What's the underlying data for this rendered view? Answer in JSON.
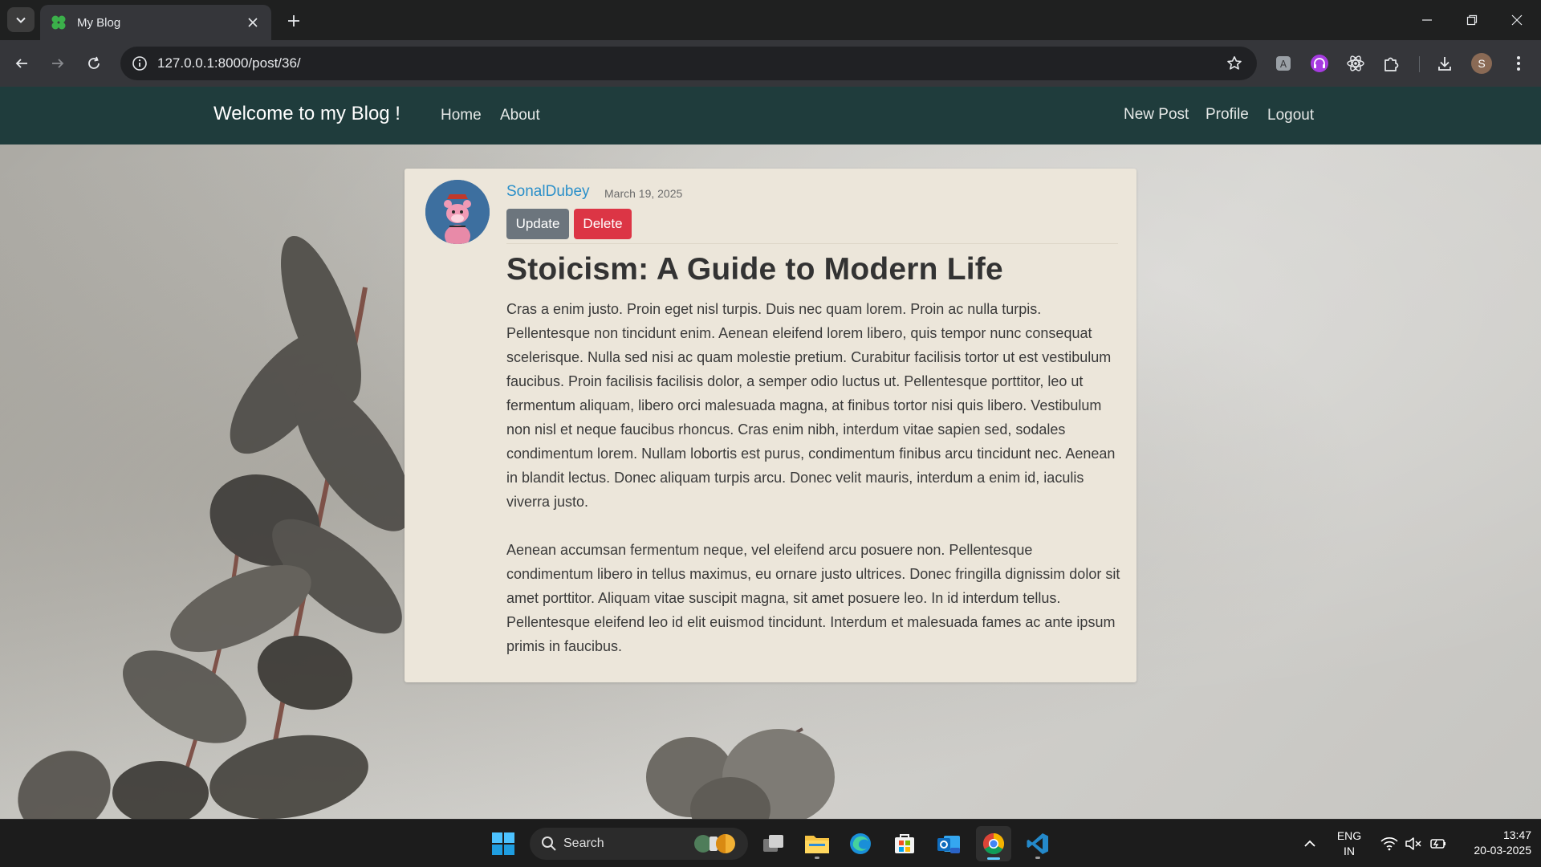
{
  "browser": {
    "tab_title": "My Blog",
    "url": "127.0.0.1:8000/post/36/",
    "profile_initial": "S"
  },
  "site": {
    "brand": "Welcome to my Blog !",
    "nav_left": [
      "Home",
      "About"
    ],
    "nav_right": [
      "New Post",
      "Profile",
      "Logout"
    ],
    "nav_bg": "#1f3c3c"
  },
  "post": {
    "author": "SonalDubey",
    "date": "March 19, 2025",
    "update_label": "Update",
    "delete_label": "Delete",
    "title": "Stoicism: A Guide to Modern Life",
    "paragraphs": [
      "Cras a enim justo. Proin eget nisl turpis. Duis nec quam lorem. Proin ac nulla turpis. Pellentesque non tincidunt enim. Aenean eleifend lorem libero, quis tempor nunc consequat scelerisque. Nulla sed nisi ac quam molestie pretium. Curabitur facilisis tortor ut est vestibulum faucibus. Proin facilisis facilisis dolor, a semper odio luctus ut. Pellentesque porttitor, leo ut fermentum aliquam, libero orci malesuada magna, at finibus tortor nisi quis libero. Vestibulum non nisl et neque faucibus rhoncus. Cras enim nibh, interdum vitae sapien sed, sodales condimentum lorem. Nullam lobortis est purus, condimentum finibus arcu tincidunt nec. Aenean in blandit lectus. Donec aliquam turpis arcu. Donec velit mauris, interdum a enim id, iaculis viverra justo.",
      "Aenean accumsan fermentum neque, vel eleifend arcu posuere non. Pellentesque condimentum libero in tellus maximus, eu ornare justo ultrices. Donec fringilla dignissim dolor sit amet porttitor. Aliquam vitae suscipit magna, sit amet posuere leo. In id interdum tellus. Pellentesque eleifend leo id elit euismod tincidunt. Interdum et malesuada fames ac ante ipsum primis in faucibus."
    ]
  },
  "taskbar": {
    "search_label": "Search",
    "lang_top": "ENG",
    "lang_bottom": "IN",
    "time": "13:47",
    "date": "20-03-2025"
  },
  "icons": {
    "tab_search": "chevron-down-icon",
    "favicon": "clover-icon",
    "tab_close": "close-icon",
    "new_tab": "plus-icon",
    "minimize": "minimize-icon",
    "restore": "restore-icon",
    "close_window": "close-icon",
    "back": "arrow-left-icon",
    "forward": "arrow-right-icon",
    "reload": "reload-icon",
    "site_info": "info-icon",
    "bookmark": "star-icon",
    "extensions": [
      "translate-icon",
      "headphones-icon",
      "react-atom-icon",
      "puzzle-icon"
    ],
    "download": "download-icon",
    "menu": "kebab-menu-icon"
  }
}
